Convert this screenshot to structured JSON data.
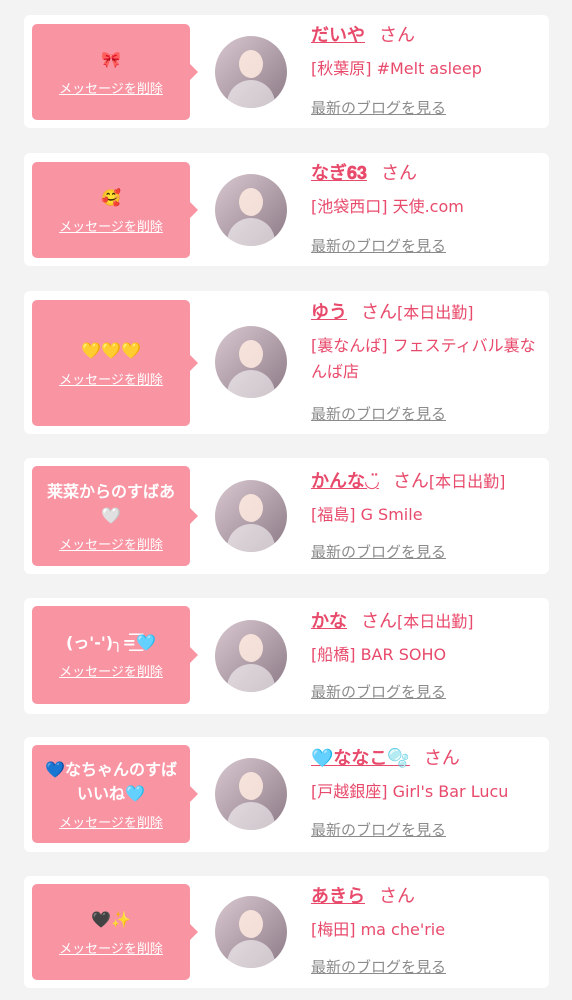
{
  "common": {
    "delete_label": "メッセージを削除",
    "honorific": "さん",
    "blog_link": "最新のブログを見る",
    "accent_color": "#f994a3",
    "name_color": "#e84a6b"
  },
  "items": [
    {
      "message": "🎀",
      "name": "だいや",
      "status": "",
      "shop": "[秋葉原] #Melt asleep"
    },
    {
      "message": "🥰",
      "name": "なぎ𝟔𝟑",
      "status": "",
      "shop": "[池袋西口] 天使.com"
    },
    {
      "message": "💛💛💛",
      "name": "ゆう",
      "status": "[本日出勤]",
      "shop": "[裏なんば] フェスティバル裏なんば店"
    },
    {
      "message": "莱菜からのすばあ🤍",
      "name": "かんな◡̈",
      "status": "[本日出勤]",
      "shop": "[福島] G Smile"
    },
    {
      "message": "(っ'-')╮=͟͟͞͞🩵",
      "name": "かな",
      "status": "[本日出勤]",
      "shop": "[船橋] BAR SOHO"
    },
    {
      "message": "💙なちゃんのすばいいね🩵",
      "name": "🩵ななこ🫧",
      "status": "",
      "shop": "[戸越銀座] Girl's Bar Lucu"
    },
    {
      "message": "🖤✨",
      "name": "あきら",
      "status": "",
      "shop": "[梅田] ma che'rie"
    }
  ]
}
